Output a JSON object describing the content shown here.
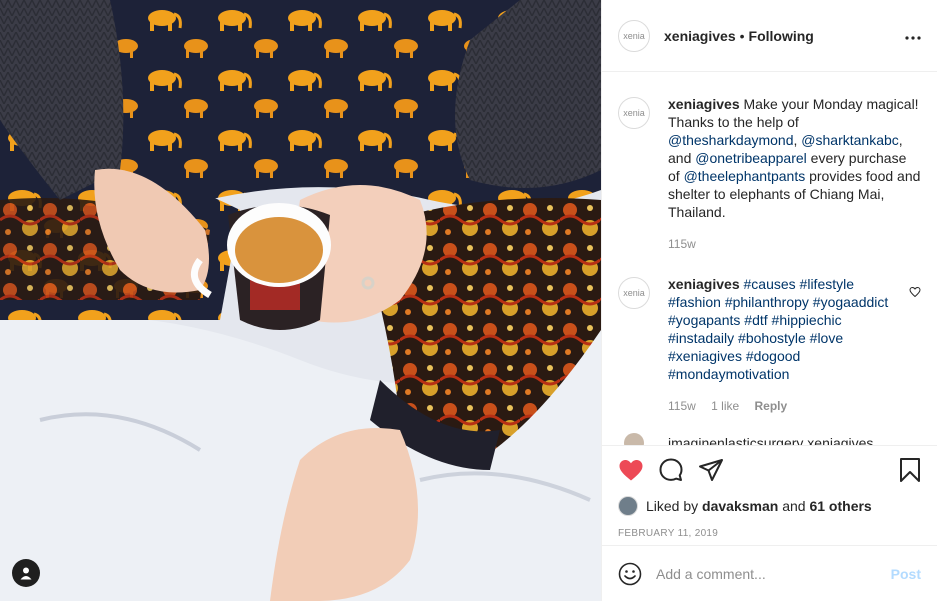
{
  "post": {
    "author": "xeniagives",
    "separator": "•",
    "follow_status": "Following",
    "more_label": "•••",
    "avatar_text": "xenia"
  },
  "caption": {
    "username": "xeniagives",
    "text_1": "Make your Monday magical! Thanks to the help of ",
    "mention_1": "@thesharkdaymond",
    "text_2": ", ",
    "mention_2": "@sharktankabc",
    "text_3": ", and ",
    "mention_3": "@onetribeapparel",
    "text_4": " every purchase of ",
    "mention_4": "@theelephantpants",
    "text_5": " provides food and shelter to elephants of Chiang Mai, Thailand.",
    "time": "115w"
  },
  "comment": {
    "username": "xeniagives",
    "hashtags": [
      "#causes",
      "#lifestyle",
      "#fashion",
      "#philanthropy",
      "#yogaaddict",
      "#yogapants",
      "#dtf",
      "#hippiechic",
      "#instadaily",
      "#bohostyle",
      "#love",
      "#xeniagives",
      "#dogood",
      "#mondaymotivation"
    ],
    "time": "115w",
    "likes": "1 like",
    "reply": "Reply"
  },
  "peek_comment": {
    "text": "imaginenlasticsurgery xeniagives"
  },
  "actions": {
    "liked": true,
    "like_color": "#ed4956",
    "likes_prefix": "Liked by ",
    "likes_user": "davaksman",
    "likes_mid": " and ",
    "likes_others": "61 others",
    "date": "FEBRUARY 11, 2019"
  },
  "composer": {
    "placeholder": "Add a comment...",
    "post_label": "Post"
  },
  "icons": {
    "like": "heart-icon",
    "comment": "comment-bubble-icon",
    "share": "paper-plane-icon",
    "save": "bookmark-icon",
    "emoji": "smiley-icon",
    "more": "ellipsis-icon",
    "photo_user": "user-silhouette-icon"
  }
}
